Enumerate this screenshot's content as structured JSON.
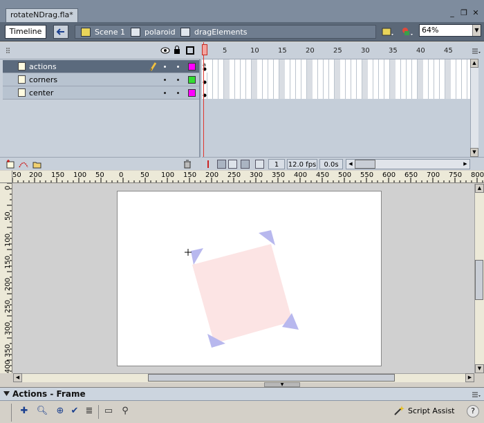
{
  "document_tab": {
    "title": "rotateNDrag.fla*"
  },
  "window_controls": {
    "minimize": "_",
    "restore": "❐",
    "close": "✕"
  },
  "editbar": {
    "timeline_label": "Timeline",
    "breadcrumbs": [
      {
        "label": "Scene 1",
        "icon": "scene-clapper-icon"
      },
      {
        "label": "polaroid",
        "icon": "movieclip-symbol-icon"
      },
      {
        "label": "dragElements",
        "icon": "movieclip-symbol-icon"
      }
    ],
    "zoom": "64%"
  },
  "timeline": {
    "layers": [
      {
        "name": "actions",
        "color": "#ff00ff",
        "selected": true,
        "editing": true
      },
      {
        "name": "corners",
        "color": "#33dd33",
        "selected": false,
        "editing": false
      },
      {
        "name": "center",
        "color": "#ff00ff",
        "selected": false,
        "editing": false
      }
    ],
    "frame_numbers": [
      "1",
      "5",
      "10",
      "15",
      "20",
      "25",
      "30",
      "35",
      "40",
      "45"
    ],
    "current_frame": "1",
    "frame_rate": "12.0 fps",
    "elapsed_time": "0.0s"
  },
  "rulers": {
    "horizontal": [
      "50",
      "200",
      "150",
      "100",
      "50",
      "0",
      "50",
      "100",
      "150",
      "200",
      "250",
      "300",
      "350",
      "400",
      "450",
      "500",
      "550",
      "600",
      "650",
      "700",
      "750",
      "800"
    ],
    "vertical": [
      "0",
      "50",
      "100",
      "150",
      "200",
      "250",
      "300",
      "350",
      "400"
    ]
  },
  "stage": {
    "background": "#ffffff",
    "polaroid_fill": "#fce4e4",
    "corner_color": "#b8b8ee"
  },
  "actions_panel": {
    "title": "Actions - Frame",
    "script_assist_label": "Script Assist",
    "help_label": "?"
  }
}
